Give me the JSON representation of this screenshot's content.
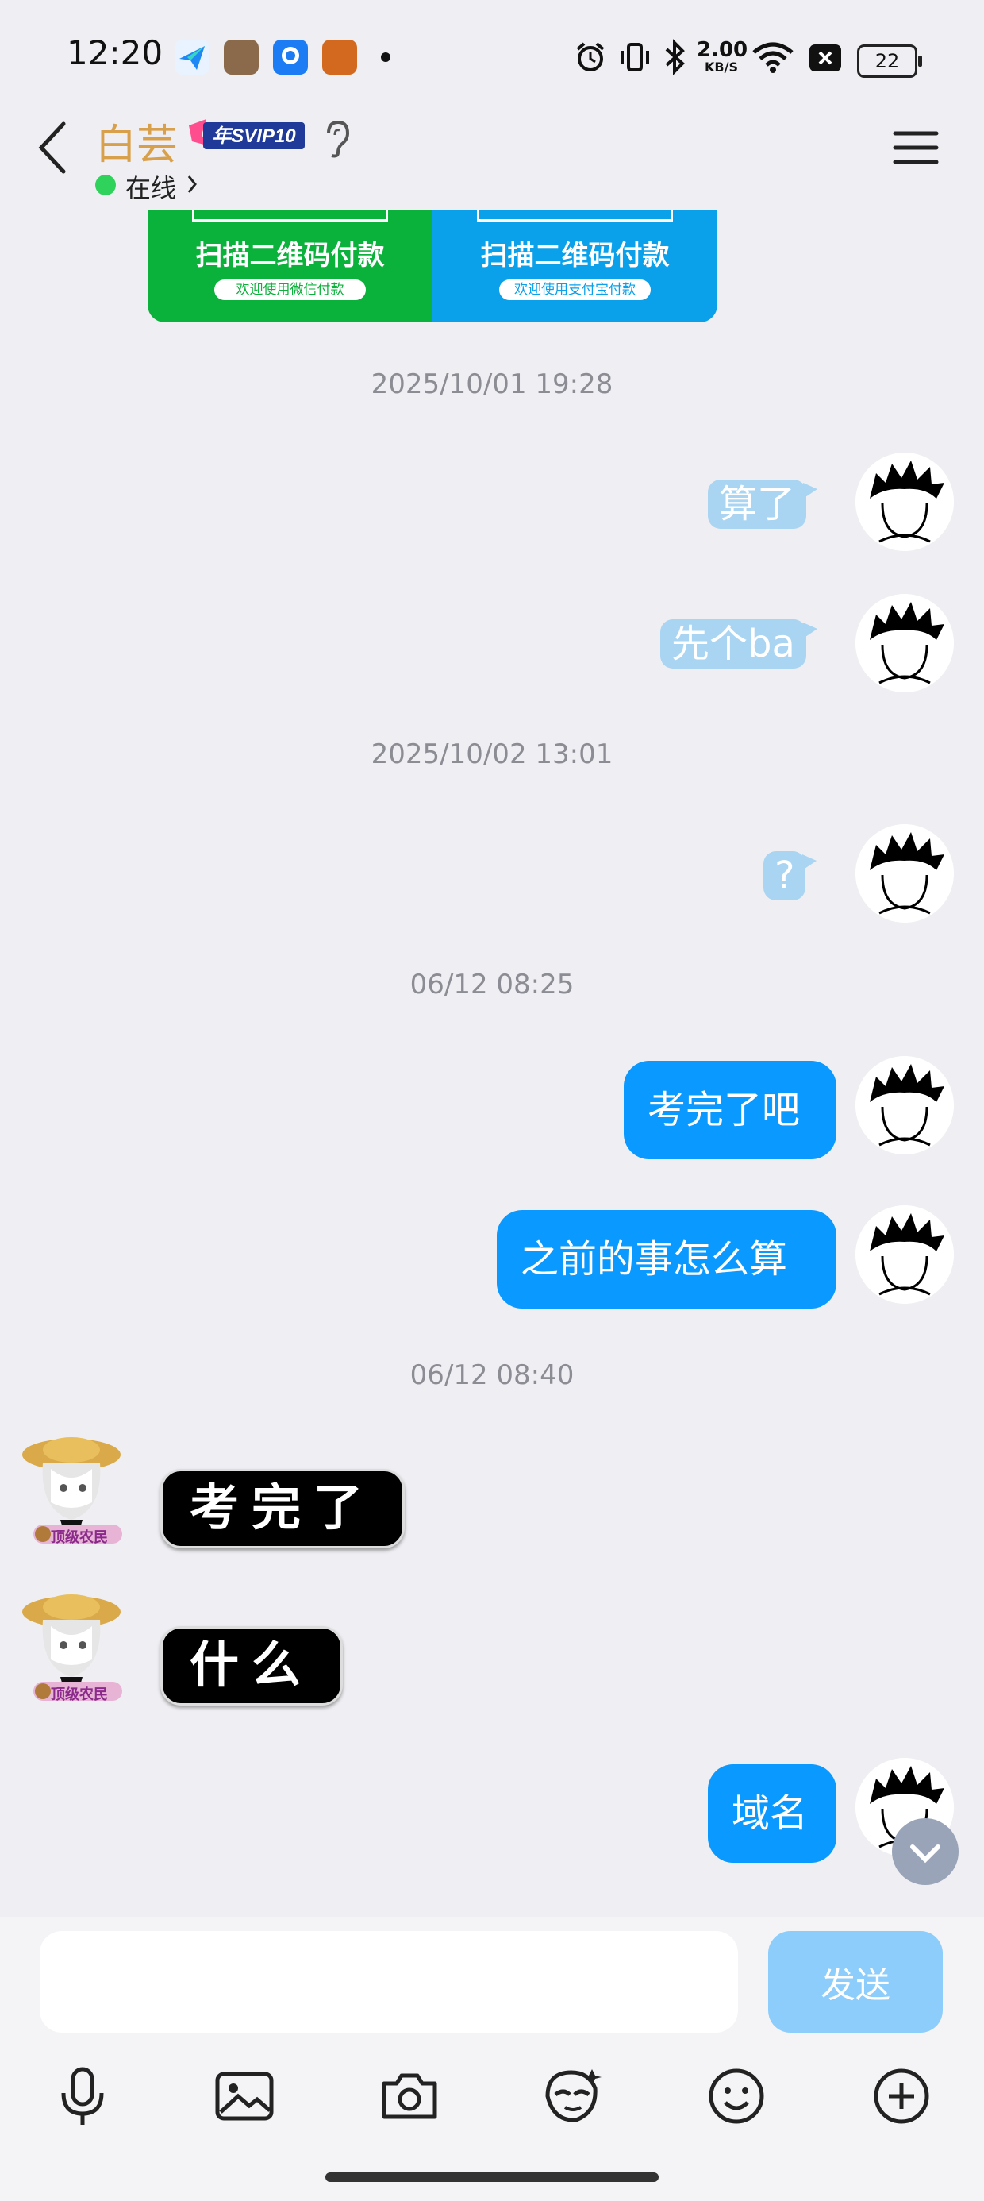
{
  "status_bar": {
    "time": "12:20",
    "net_speed_value": "2.00",
    "net_speed_unit": "KB/S",
    "battery": "22"
  },
  "header": {
    "contact_name": "白芸",
    "svip_badge": "年SVIP10",
    "online_status": "在线"
  },
  "qr_cards": [
    {
      "title": "扫描二维码付款",
      "subtitle": "欢迎使用微信付款",
      "color": "#0ab13a"
    },
    {
      "title": "扫描二维码付款",
      "subtitle": "欢迎使用支付宝付款",
      "color": "#0aa0ea"
    }
  ],
  "timestamps": [
    "2025/10/01 19:28",
    "2025/10/02 13:01",
    "06/12 08:25",
    "06/12 08:40"
  ],
  "messages": [
    {
      "from": "me",
      "type": "sticker",
      "text": "算了"
    },
    {
      "from": "me",
      "type": "sticker",
      "text": "先个ba"
    },
    {
      "from": "me",
      "type": "sticker",
      "text": "?"
    },
    {
      "from": "me",
      "type": "text",
      "text": "考完了吧"
    },
    {
      "from": "me",
      "type": "text",
      "text": "之前的事怎么算"
    },
    {
      "from": "contact",
      "type": "styled",
      "text": "考完了"
    },
    {
      "from": "contact",
      "type": "styled",
      "text": "什么"
    },
    {
      "from": "me",
      "type": "text",
      "text": "域名"
    }
  ],
  "contact_avatar_badge": "顶级农民",
  "input_bar": {
    "placeholder": "",
    "send_label": "发送"
  },
  "toolbar_icons": [
    "microphone-icon",
    "image-icon",
    "camera-icon",
    "sticker-icon",
    "emoji-icon",
    "plus-icon"
  ],
  "colors": {
    "accent": "#0a99ff",
    "name": "#d9a04b",
    "online": "#2fd25b"
  }
}
